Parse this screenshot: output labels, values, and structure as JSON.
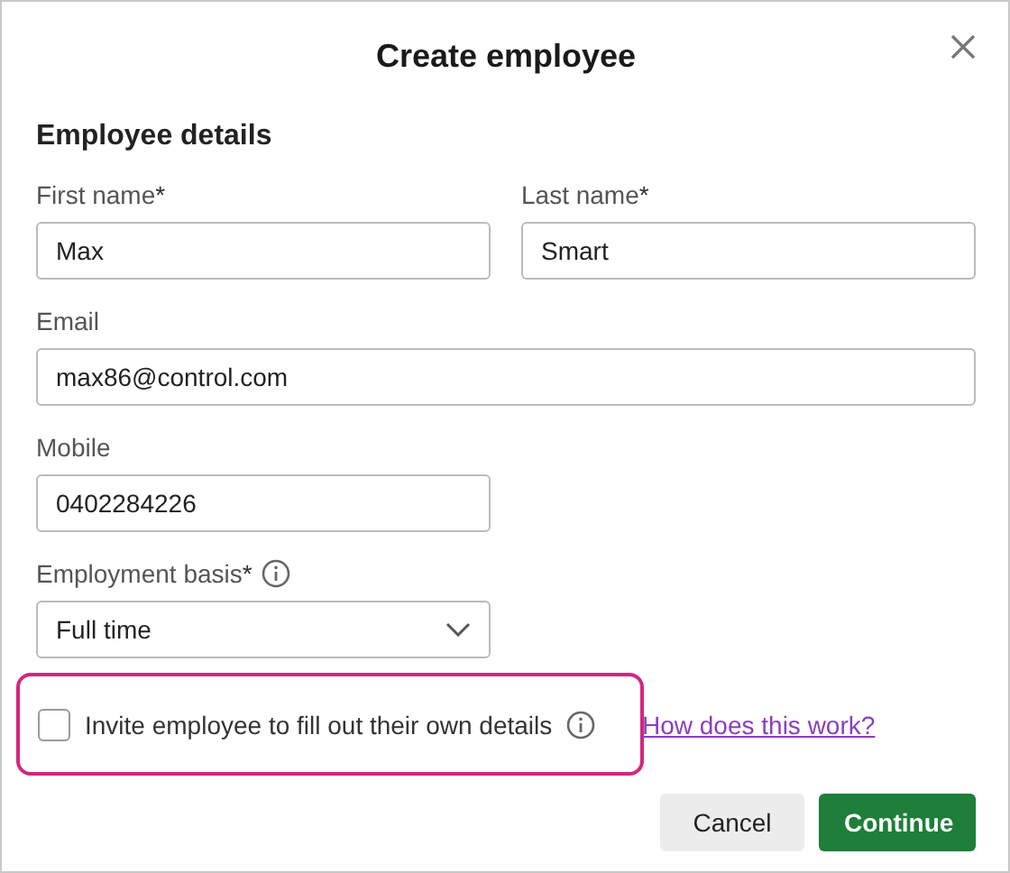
{
  "dialog": {
    "title": "Create employee"
  },
  "section_title": "Employee details",
  "rows": [
    {
      "fields": [
        {
          "kind": "text",
          "label": "First name",
          "marker": "*",
          "info": false,
          "value": "Max",
          "wide": false
        },
        {
          "kind": "text",
          "label": "Last name",
          "marker": "*",
          "info": false,
          "value": "Smart",
          "wide": false
        }
      ]
    },
    {
      "fields": [
        {
          "kind": "text",
          "label": "Email",
          "info": false,
          "value": "max86@control.com",
          "wide": true
        }
      ]
    },
    {
      "fields": [
        {
          "kind": "text",
          "label": "Mobile",
          "info": false,
          "value": "0402284226",
          "wide": false
        }
      ]
    },
    {
      "fields": [
        {
          "kind": "select",
          "label": "Employment basis",
          "marker": "*",
          "info": true,
          "value": "Full time",
          "wide": false
        }
      ]
    }
  ],
  "invite": {
    "label": "Invite employee to fill out their own details",
    "checked": false,
    "highlighted": true,
    "link": "How does this work?"
  },
  "buttons": [
    {
      "label": "Cancel",
      "kind": "secondary"
    },
    {
      "label": "Continue",
      "kind": "primary"
    }
  ]
}
